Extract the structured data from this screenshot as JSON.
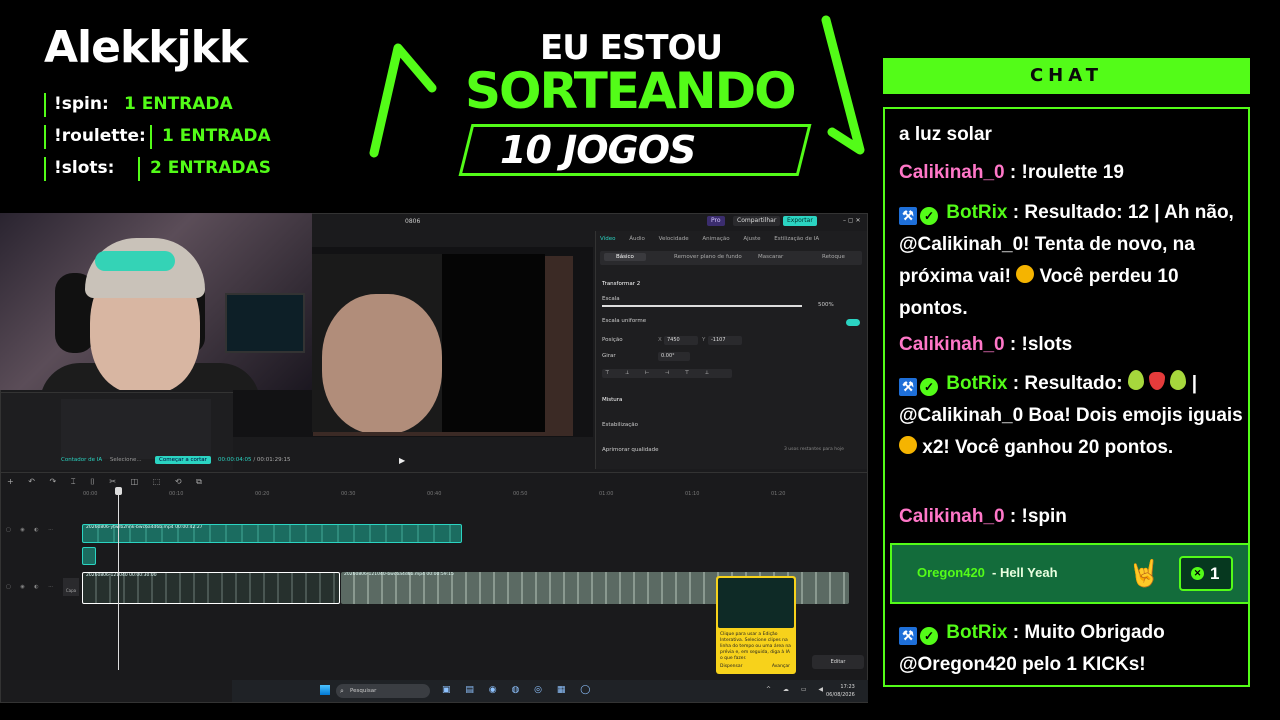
{
  "overlay": {
    "streamer": "Alekkjkk",
    "commands": [
      {
        "name": "!spin:",
        "value": "1 ENTRADA"
      },
      {
        "name": "!roulette:",
        "value": "1 ENTRADA"
      },
      {
        "name": "!slots:",
        "value": "2 ENTRADAS"
      }
    ],
    "headline": {
      "line1": "EU ESTOU",
      "line2": "SORTEANDO",
      "line3": "10 JOGOS"
    },
    "accent": "#53fc18"
  },
  "editor": {
    "title": "0806",
    "top_buttons": {
      "pro": "Pro",
      "share": "Compartilhar",
      "export": "Exportar"
    },
    "tabs": [
      "Vídeo",
      "Áudio",
      "Velocidade",
      "Animação",
      "Ajuste",
      "Estilização de IA"
    ],
    "subtabs": [
      "Básico",
      "Remover plano de fundo",
      "Mascarar",
      "Retoque"
    ],
    "props": {
      "transform": "Transformar 2",
      "scale_label": "Escala",
      "scale_value": "500%",
      "uniform_label": "Escala uniforme",
      "position_label": "Posição",
      "pos_x_label": "X",
      "pos_x": "7450",
      "pos_y_label": "Y",
      "pos_y": "-1107",
      "rotate_label": "Girar",
      "rotate": "0.00°",
      "mix_label": "Mistura",
      "stabilize_label": "Estabilização",
      "enhance_label": "Aprimorar qualidade",
      "enhance_note": "3 usos restantes para hoje"
    },
    "left_panel": {
      "counter": "Contador de IA",
      "select": "Selecione...",
      "start": "Começar a cortar"
    },
    "preview": {
      "current_time": "00:00:04:05",
      "total_time": "00:01:29:15"
    },
    "ruler": [
      "00:00",
      "00:10",
      "00:20",
      "00:30",
      "00:40",
      "00:50",
      "01:00",
      "01:10",
      "01:20"
    ],
    "tracks": {
      "t1_label": "20260806-ytwrb2hnk-bwc6a4d6b.mp4   00:00:42:27",
      "t3a_label": "20260806-121040 00:00:30:00",
      "t3b_label": "20260806-121040-bwc6a4d6b.mp4   00:00:59:15"
    },
    "capa": "Capa",
    "tip": {
      "text": "Clique para usar a Edição Interativa. Selecione clipes na linha do tempo ou uma área na prévia e, em seguida, diga à IA o que fazer.",
      "nav": "Avançar",
      "skip": "Dispensar"
    },
    "edit_button": "Editar"
  },
  "taskbar": {
    "search_placeholder": "Pesquisar",
    "time": "17:23",
    "date": "06/08/2026"
  },
  "chat": {
    "header": "CHAT",
    "messages": [
      {
        "type": "plain",
        "text": "a luz solar"
      },
      {
        "user": "Calikinah_0",
        "text": "!roulette 19"
      },
      {
        "user": "BotRix",
        "text_a": "Resultado: 12 | Ah não, ",
        "mention": "@Calikinah_0",
        "text_b": "! Tenta de novo, na próxima vai!",
        "text_c": "Você perdeu 10 pontos."
      },
      {
        "user": "Calikinah_0",
        "text": "!slots"
      },
      {
        "user": "BotRix",
        "text_a": "Resultado:",
        "text_sep": "|",
        "mention": "@Calikinah_0",
        "text_b": "Boa! Dois emojis iguais",
        "text_c": "x2! Você ganhou 20 pontos."
      },
      {
        "user": "Calikinah_0",
        "text": "!spin"
      },
      {
        "user": "BotRix",
        "text_a": "Muito Obrigado",
        "mention": "@Oregon420",
        "text_b": "pelo 1 KICKs!"
      }
    ],
    "kick": {
      "user": "Oregon420",
      "message": "- Hell Yeah",
      "amount": "1"
    },
    "sep": ":"
  }
}
